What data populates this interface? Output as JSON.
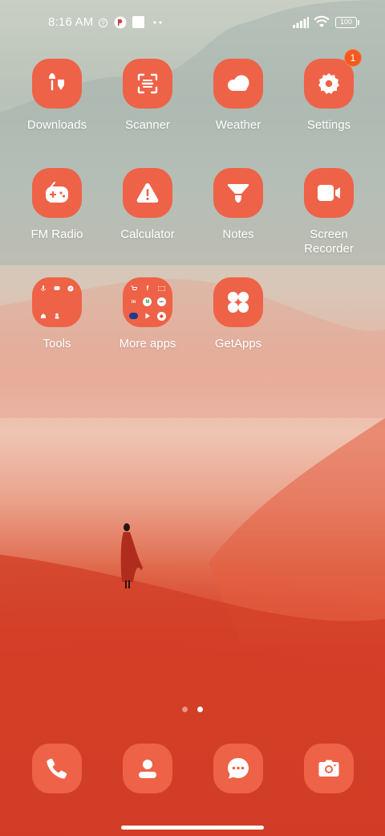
{
  "status_bar": {
    "time": "8:16 AM",
    "battery": "100",
    "icons": [
      "data-saver-icon",
      "notification-app-icon",
      "white-square-icon",
      "more-dots-icon",
      "signal-icon",
      "wifi-icon",
      "battery-icon"
    ]
  },
  "apps": [
    {
      "label": "Downloads",
      "icon": "download-icon"
    },
    {
      "label": "Scanner",
      "icon": "scanner-icon"
    },
    {
      "label": "Weather",
      "icon": "cloud-icon"
    },
    {
      "label": "Settings",
      "icon": "gear-icon",
      "badge": "1"
    },
    {
      "label": "FM Radio",
      "icon": "radio-icon"
    },
    {
      "label": "Calculator",
      "icon": "warning-triangle-icon"
    },
    {
      "label": "Notes",
      "icon": "funnel-icon"
    },
    {
      "label": "Screen\nRecorder",
      "icon": "video-camera-icon"
    },
    {
      "label": "Tools",
      "icon": "folder-icon"
    },
    {
      "label": "More apps",
      "icon": "folder-icon"
    },
    {
      "label": "GetApps",
      "icon": "getapps-icon"
    }
  ],
  "dock": [
    {
      "name": "phone",
      "icon": "phone-icon"
    },
    {
      "name": "contacts",
      "icon": "contact-icon"
    },
    {
      "name": "messages",
      "icon": "message-icon"
    },
    {
      "name": "camera",
      "icon": "camera-icon"
    }
  ],
  "page_indicator": {
    "pages": 2,
    "active": 2
  },
  "colors": {
    "icon_bg": "#ee6248",
    "badge": "#f25a1e",
    "label": "#ffffff"
  }
}
